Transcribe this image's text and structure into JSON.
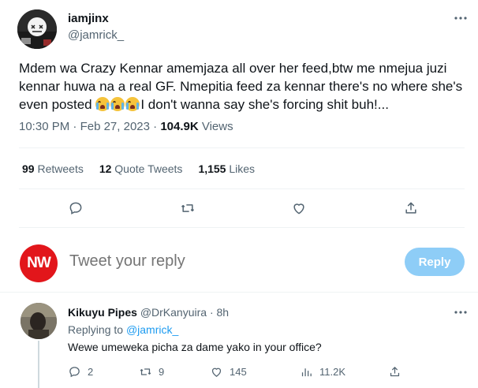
{
  "tweet": {
    "display_name": "iamjinx",
    "handle": "@jamrick_",
    "text_part1": "Mdem wa Crazy Kennar amemjaza all over her feed,btw me nmejua juzi kennar huwa na a real GF. Nmepitia  feed za kennar there's no where she's even posted ",
    "text_part2": "I don't wanna say she's forcing shit buh!...",
    "time": "10:30 PM",
    "date": "Feb 27, 2023",
    "views_count": "104.9K",
    "views_label": "Views",
    "retweets_count": "99",
    "retweets_label": "Retweets",
    "quotes_count": "12",
    "quotes_label": "Quote Tweets",
    "likes_count": "1,155",
    "likes_label": "Likes"
  },
  "composer": {
    "avatar_text": "NW",
    "placeholder": "Tweet your reply",
    "button_label": "Reply"
  },
  "reply": {
    "display_name": "Kikuyu Pipes",
    "handle": "@DrKanyuira",
    "time": "8h",
    "replying_label": "Replying to",
    "replying_handle": "@jamrick_",
    "text": "Wewe umeweka picha za dame yako in your office?",
    "replies": "2",
    "retweets": "9",
    "likes": "145",
    "views": "11.2K"
  },
  "icons": {
    "reply": "reply-icon",
    "retweet": "retweet-icon",
    "like": "heart-icon",
    "share": "share-icon",
    "views": "views-icon",
    "more": "more-icon"
  },
  "colors": {
    "accent": "#1d9bf0",
    "reply_button": "#8ecdf7",
    "nw_red": "#e2161b"
  }
}
